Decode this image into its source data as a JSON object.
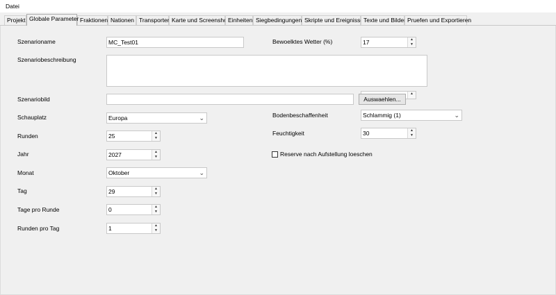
{
  "menubar": {
    "file_label": "Datei"
  },
  "tabs": [
    {
      "label": "Projekt"
    },
    {
      "label": "Globale Parameter"
    },
    {
      "label": "Fraktionen"
    },
    {
      "label": "Nationen"
    },
    {
      "label": "Transporter"
    },
    {
      "label": "Karte und Screenshot"
    },
    {
      "label": "Einheiten"
    },
    {
      "label": "Siegbedingungen"
    },
    {
      "label": "Skripte und Ereignisse"
    },
    {
      "label": "Texte und Bilder"
    },
    {
      "label": "Pruefen und Exportieren"
    }
  ],
  "left": {
    "scenario_name": {
      "label": "Szenarioname",
      "value": "MC_Test01"
    },
    "scenario_description": {
      "label": "Szenariobeschreibung",
      "value": ""
    },
    "scenario_image": {
      "label": "Szenariobild",
      "value": ""
    },
    "venue": {
      "label": "Schauplatz",
      "value": "Europa"
    },
    "rounds": {
      "label": "Runden",
      "value": "25"
    },
    "year": {
      "label": "Jahr",
      "value": "2027"
    },
    "month": {
      "label": "Monat",
      "value": "Oktober"
    },
    "day": {
      "label": "Tag",
      "value": "29"
    },
    "days_per_round": {
      "label": "Tage pro Runde",
      "value": "0"
    },
    "rounds_per_day": {
      "label": "Runden pro Tag",
      "value": "1"
    }
  },
  "right": {
    "cloudy_weather": {
      "label": "Bewoelktes Wetter (%)",
      "value": "17"
    },
    "hidden_spin": {
      "value": ""
    },
    "ground_condition": {
      "label": "Bodenbeschaffenheit",
      "value": "Schlammig (1)"
    },
    "humidity": {
      "label": "Feuchtigkeit",
      "value": "30"
    },
    "reserve_checkbox": {
      "label": "Reserve nach Aufstellung loeschen",
      "checked": false
    }
  },
  "browse_button": {
    "label": "Auswaehlen..."
  }
}
